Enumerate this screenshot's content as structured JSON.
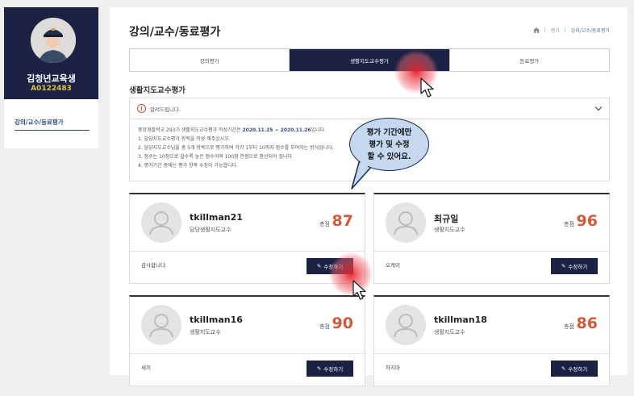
{
  "sidebar": {
    "name": "김청년교육생",
    "id": "A0122483",
    "menu_item": "강의/교수/동료평가"
  },
  "header": {
    "title": "강의/교수/동료평가",
    "breadcrumb": [
      "평가",
      "강의/교수/동료평가"
    ]
  },
  "tabs": [
    {
      "label": "강의평가",
      "active": false
    },
    {
      "label": "생활지도교수평가",
      "active": true
    },
    {
      "label": "동료평가",
      "active": false
    }
  ],
  "section_title": "생활지도교수평가",
  "notice": {
    "head": "알려드립니다.",
    "line1_pre": "중앙경찰학교 293기 생활지도교수평가 작성기간은 ",
    "line1_period": "2020.11.25 ~ 2020.11.26",
    "line1_post": "입니다.",
    "line2": "1. 담당지도교수평가 항목을 작성 해주십시오.",
    "line3": "2. 담당지도교수님을 총 5개 항목으로 평가하여 각각 1부터 10까지 점수를 부여하는 방식입니다.",
    "line4": "3. 점수는 10점으로 갈수록 높은 점수이며 100점 만점으로 환산되어 집니다.",
    "line5": "4. 평가기간 중에는 평가 항목 수정이 가능합니다."
  },
  "callout": {
    "line1": "평가 기간에만",
    "line2": "평가 및 수정",
    "line3": "할 수 있어요."
  },
  "cards": [
    {
      "name": "tkillman21",
      "role": "담당생활지도교수",
      "score_label": "총점",
      "score": "87",
      "comment": "감사합니다.",
      "button": "수정하기"
    },
    {
      "name": "최규일",
      "role": "생활지도교수",
      "score_label": "총점",
      "score": "96",
      "comment": "오케이",
      "button": "수정하기"
    },
    {
      "name": "tkillman16",
      "role": "생활지도교수",
      "score_label": "총점",
      "score": "90",
      "comment": "세끼",
      "button": "수정하기"
    },
    {
      "name": "tkillman18",
      "role": "생활지도교수",
      "score_label": "총점",
      "score": "86",
      "comment": "하지마",
      "button": "수정하기"
    }
  ],
  "colors": {
    "navy": "#1c2244",
    "score": "#d05a3a",
    "accent_id": "#e0c341"
  },
  "icons": [
    "home-icon",
    "warning-icon",
    "chevron-down-icon",
    "pencil-icon",
    "person-icon"
  ]
}
